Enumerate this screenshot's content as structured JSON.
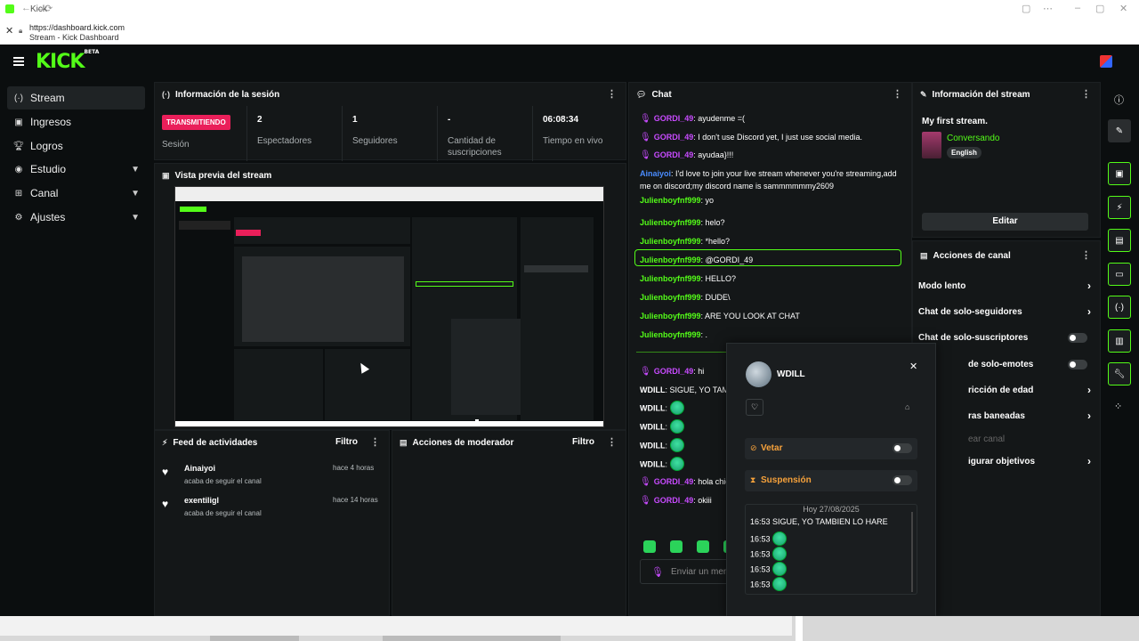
{
  "browser": {
    "tab_title": "Kick",
    "url": "https://dashboard.kick.com",
    "page_title": "Stream - Kick Dashboard"
  },
  "app": {
    "logo_text": "KICK",
    "logo_badge": "BETA"
  },
  "sidebar": {
    "items": [
      {
        "label": "Stream",
        "icon": "broadcast-icon"
      },
      {
        "label": "Ingresos",
        "icon": "money-icon"
      },
      {
        "label": "Logros",
        "icon": "trophy-icon"
      },
      {
        "label": "Estudio",
        "icon": "studio-icon"
      },
      {
        "label": "Canal",
        "icon": "channel-icon"
      },
      {
        "label": "Ajustes",
        "icon": "gear-icon"
      }
    ]
  },
  "session": {
    "title": "Información de la sesión",
    "live_badge": "TRANSMITIENDO",
    "session_label": "Sesión",
    "stats": [
      {
        "value": "2",
        "label": "Espectadores"
      },
      {
        "value": "1",
        "label": "Seguidores"
      },
      {
        "value": "-",
        "label": "Cantidad de suscripciones"
      },
      {
        "value": "06:08:34",
        "label": "Tiempo en vivo"
      }
    ]
  },
  "preview": {
    "title": "Vista previa del stream"
  },
  "activity": {
    "title": "Feed de actividades",
    "filter": "Filtro",
    "items": [
      {
        "name": "Ainaiyoi",
        "desc": "acaba de seguir el canal",
        "time": "hace 4 horas"
      },
      {
        "name": "exentiligl",
        "desc": "acaba de seguir el canal",
        "time": "hace 14 horas"
      }
    ]
  },
  "moderator": {
    "title": "Acciones de moderador",
    "filter": "Filtro"
  },
  "chat": {
    "title": "Chat",
    "input_placeholder": "Enviar un men",
    "messages": [
      {
        "user": "GORDI_49",
        "text": "ayudenme =(",
        "color": "pur",
        "mic": true
      },
      {
        "user": "GORDI_49",
        "text": "I don't use Discord yet, I just use social media.",
        "color": "pur",
        "mic": true
      },
      {
        "user": "GORDI_49",
        "text": "ayudaa}!!!",
        "color": "pur",
        "mic": true
      },
      {
        "user": "Ainaiyoi",
        "text": "I'd love to join your live stream whenever you're streaming,add me on discord;my discord name is sammmmmmy2609",
        "color": "blue",
        "mic": false
      },
      {
        "user": "Julienboyfnf999",
        "text": "yo",
        "color": "green",
        "mic": false
      },
      {
        "user": "Julienboyfnf999",
        "text": "helo?",
        "color": "green",
        "mic": false
      },
      {
        "user": "Julienboyfnf999",
        "text": "*hello?",
        "color": "green",
        "mic": false
      },
      {
        "user": "Julienboyfnf999",
        "text": "@GORDI_49",
        "color": "green",
        "mic": false
      },
      {
        "user": "Julienboyfnf999",
        "text": "HELLO?",
        "color": "green",
        "mic": false
      },
      {
        "user": "Julienboyfnf999",
        "text": "DUDE\\",
        "color": "green",
        "mic": false
      },
      {
        "user": "Julienboyfnf999",
        "text": "ARE YOU LOOK AT CHAT",
        "color": "green",
        "mic": false
      },
      {
        "user": "Julienboyfnf999",
        "text": ".",
        "color": "green",
        "mic": false
      },
      {
        "user": "GORDI_49",
        "text": "hi",
        "color": "pur",
        "mic": true
      },
      {
        "user": "WDILL",
        "text": "SIGUE, YO TAM",
        "color": "w",
        "mic": false
      },
      {
        "user": "WDILL",
        "text": "",
        "color": "w",
        "mic": false,
        "emote": true
      },
      {
        "user": "WDILL",
        "text": "",
        "color": "w",
        "mic": false,
        "emote": true
      },
      {
        "user": "WDILL",
        "text": "",
        "color": "w",
        "mic": false,
        "emote": true
      },
      {
        "user": "WDILL",
        "text": "",
        "color": "w",
        "mic": false,
        "emote": true
      },
      {
        "user": "GORDI_49",
        "text": "hola chic",
        "color": "pur",
        "mic": true
      },
      {
        "user": "GORDI_49",
        "text": "okiii",
        "color": "pur",
        "mic": true
      }
    ]
  },
  "stream_info": {
    "title": "Información del stream",
    "stream_title": "My first stream.",
    "category": "Conversando",
    "language": "English",
    "edit_label": "Editar"
  },
  "channel_actions": {
    "title": "Acciones de canal",
    "rows": [
      {
        "label": "Modo lento",
        "control": "arrow"
      },
      {
        "label": "Chat de solo-seguidores",
        "control": "arrow"
      },
      {
        "label": "Chat de solo-suscriptores",
        "control": "toggle"
      },
      {
        "label": "de solo-emotes",
        "control": "toggle"
      },
      {
        "label": "ricción de edad",
        "control": "arrow"
      },
      {
        "label": "ras baneadas",
        "control": "arrow"
      },
      {
        "label": "ear canal",
        "control": "none"
      },
      {
        "label": "igurar objetivos",
        "control": "arrow"
      }
    ]
  },
  "user_card": {
    "username": "WDILL",
    "ban_label": "Vetar",
    "timeout_label": "Suspensión",
    "date_header": "Hoy 27/08/2025",
    "history": [
      {
        "time": "16:53",
        "text": "SIGUE, YO TAMBIEN LO HARE"
      },
      {
        "time": "16:53",
        "text": ""
      },
      {
        "time": "16:53",
        "text": ""
      },
      {
        "time": "16:53",
        "text": ""
      },
      {
        "time": "16:53",
        "text": ""
      }
    ]
  },
  "colors": {
    "accent": "#53fc18",
    "live": "#ea1f5a",
    "mic": "#c84bff",
    "bg": "#0b0e0f",
    "panel": "#141718"
  }
}
